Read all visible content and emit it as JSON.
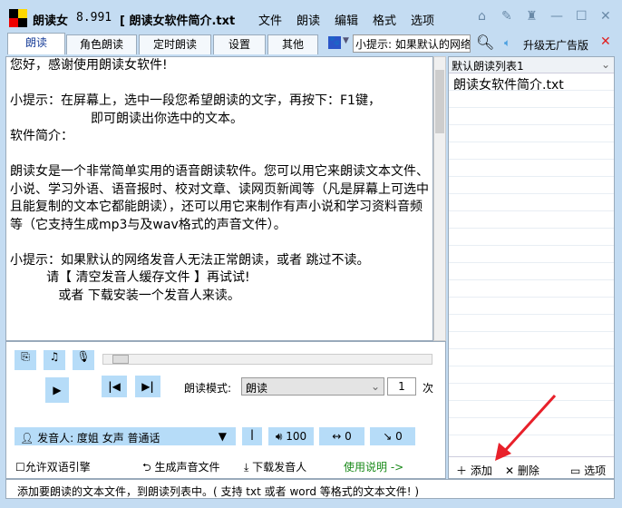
{
  "app": {
    "name": "朗读女",
    "version": "8.991",
    "doc": "[ 朗读女软件简介.txt"
  },
  "menu": [
    "文件",
    "朗读",
    "编辑",
    "格式",
    "选项"
  ],
  "tabs": [
    "朗读",
    "角色朗读",
    "定时朗读",
    "设置",
    "其他"
  ],
  "search": {
    "value": "小提示: 如果默认的网络"
  },
  "upgrade": "升级无广告版",
  "text": "您好，感谢使用朗读女软件!\n\n小提示：在屏幕上，选中一段您希望朗读的文字，再按下：F1键，\n                    即可朗读出你选中的文本。\n软件简介：\n\n朗读女是一个非常简单实用的语音朗读软件。您可以用它来朗读文本文件、小说、学习外语、语音报时、校对文章、读网页新闻等（凡是屏幕上可选中且能复制的文本它都能朗读），还可以用它来制作有声小说和学习资料音频等（它支持生成mp3与及wav格式的声音文件）。\n\n小提示：如果默认的网络发音人无法正常朗读，或者 跳过不读。\n         请【 清空发音人缓存文件 】再试试!\n            或者 下载安装一个发音人来读。",
  "playlist": {
    "name": "默认朗读列表1",
    "items": [
      "朗读女软件简介.txt"
    ],
    "add": "添加",
    "delete": "删除",
    "options": "选项"
  },
  "controls": {
    "mode_label": "朗读模式:",
    "mode": "朗读",
    "repeat": "1",
    "repeat_unit": "次",
    "voice": "发音人: 度姐 女声 普通话",
    "volume": "100",
    "speed": "0",
    "pitch": "0",
    "bilingual": "允许双语引擎",
    "generate": "生成声音文件",
    "download": "下载发音人",
    "help": "使用说明 ->"
  },
  "status": "添加要朗读的文本文件，到朗读列表中。( 支持 txt 或者 word 等格式的文本文件! )",
  "colors": {
    "accent": "#b6dcf8",
    "help": "#1a8a1a",
    "arrow": "#e8202a"
  }
}
